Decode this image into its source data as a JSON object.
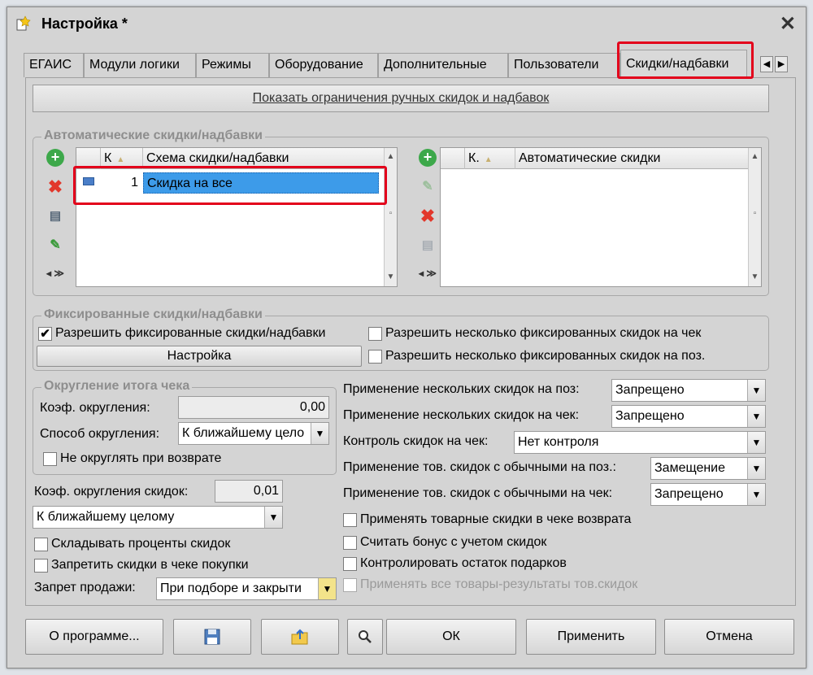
{
  "window": {
    "title": "Настройка *",
    "close": "✕"
  },
  "tabs": [
    "ЕГАИС",
    "Модули логики",
    "Режимы",
    "Оборудование",
    "Дополнительные",
    "Пользователи",
    "Скидки/надбавки"
  ],
  "show_limits_link": "Показать ограничения ручных скидок и надбавок",
  "auto": {
    "title": "Автоматические скидки/надбавки",
    "left_grid": {
      "col_k": "К",
      "col_name": "Схема скидки/надбавки",
      "rows": [
        {
          "k": "1",
          "name": "Скидка на все"
        }
      ]
    },
    "right_grid": {
      "col_k": "К.",
      "col_name": "Автоматические скидки"
    }
  },
  "fixed": {
    "title": "Фиксированные скидки/надбавки",
    "allow_fixed": "Разрешить фиксированные скидки/надбавки",
    "allow_fixed_checked": true,
    "settings_button": "Настройка",
    "multi_per_check": "Разрешить несколько фиксированных скидок на чек",
    "multi_per_item": "Разрешить несколько фиксированных скидок на поз."
  },
  "rounding": {
    "title": "Округление итога чека",
    "coef_label": "Коэф. округления:",
    "coef_value": "0,00",
    "method_label": "Способ округления:",
    "method_value": "К ближайшему цело",
    "no_round_return": "Не округлять при возврате"
  },
  "discount_rounding": {
    "coef_label": "Коэф. округления скидок:",
    "coef_value": "0,01",
    "method_value": "К ближайшему целому"
  },
  "left_checks": {
    "sum_percents": "Складывать проценты скидок",
    "forbid_purchase": "Запретить скидки в чеке покупки"
  },
  "sale_ban": {
    "label": "Запрет продажи:",
    "value": "При подборе и закрыти"
  },
  "right_fields": [
    {
      "label": "Применение нескольких скидок на поз:",
      "value": "Запрещено"
    },
    {
      "label": "Применение нескольких скидок на чек:",
      "value": "Запрещено"
    },
    {
      "label": "Контроль скидок на чек:",
      "value": "Нет контроля"
    },
    {
      "label": "Применение тов. скидок с обычными на поз.:",
      "value": "Замещение"
    },
    {
      "label": "Применение тов. скидок с обычными на чек:",
      "value": "Запрещено"
    }
  ],
  "right_checks": {
    "goods_in_return": "Применять товарные скидки в чеке возврата",
    "bonus_with_discounts": "Считать бонус с учетом скидок",
    "control_gifts": "Контролировать остаток подарков",
    "apply_all_results": "Применять все товары-результаты тов.скидок"
  },
  "footer": {
    "about": "О программе...",
    "ok": "ОК",
    "apply": "Применить",
    "cancel": "Отмена"
  },
  "icons": {
    "window": "settings-window-icon",
    "save": "floppy-disk-icon",
    "export": "folder-export-icon",
    "search": "magnifier-icon"
  }
}
